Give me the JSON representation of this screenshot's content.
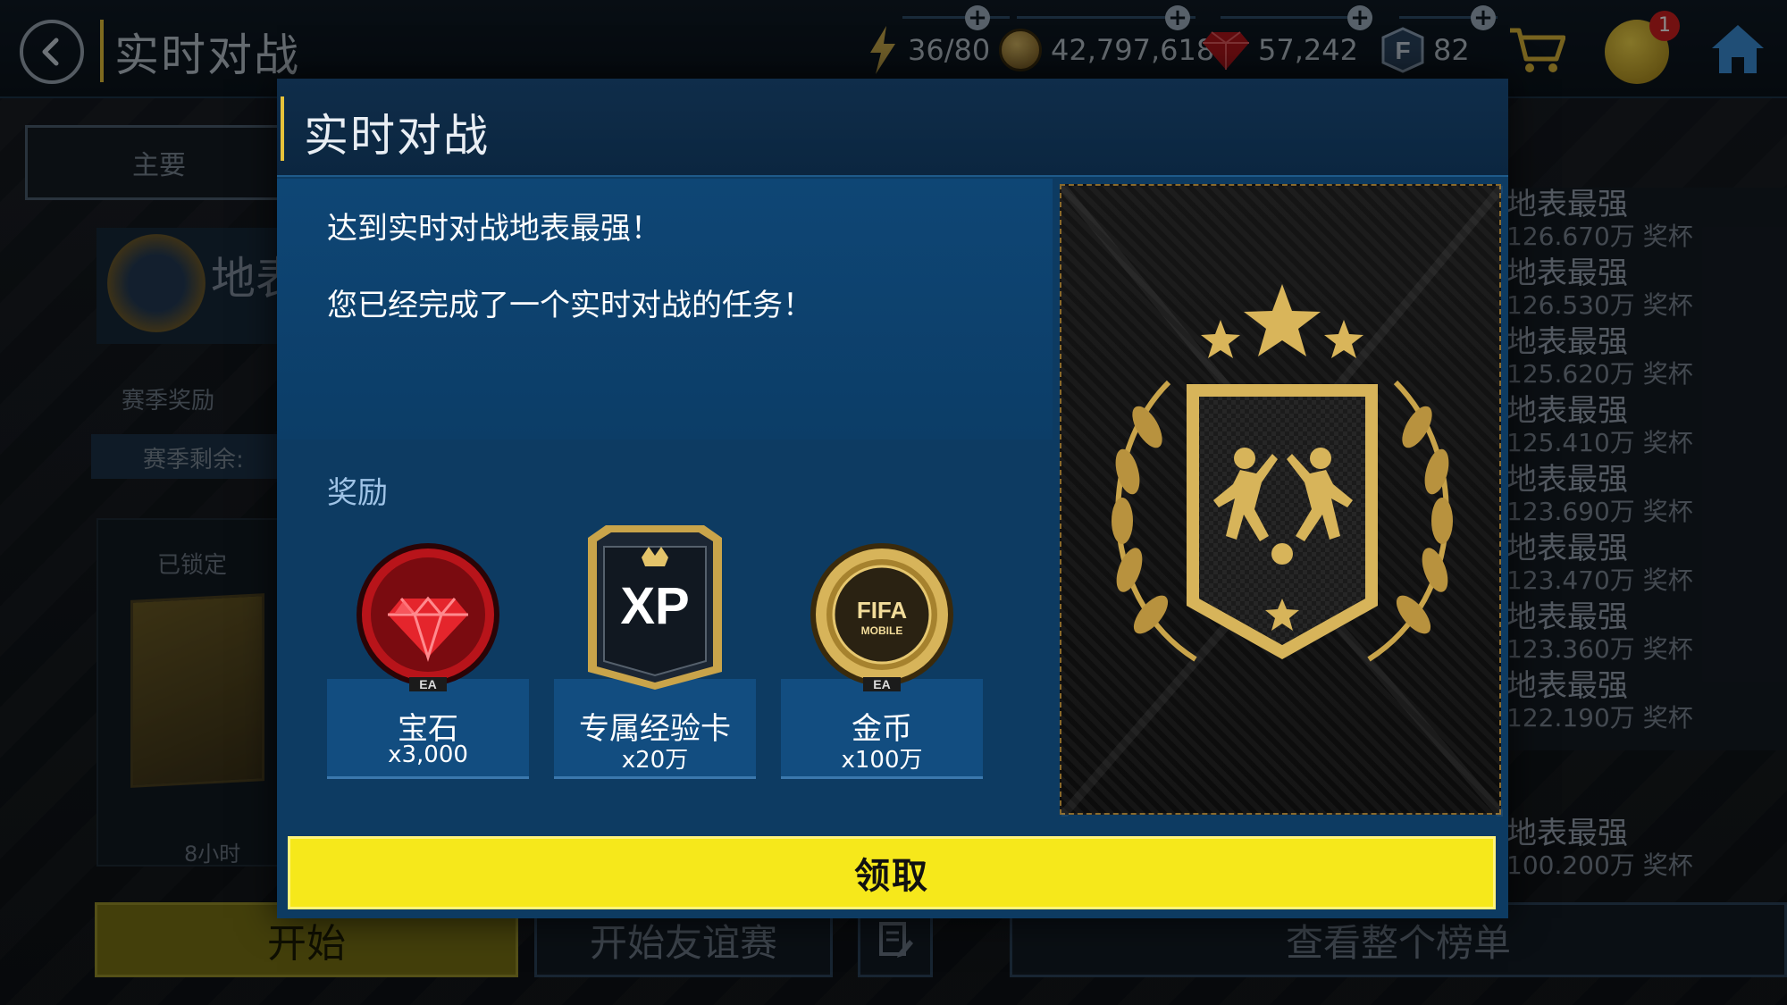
{
  "topbar": {
    "title": "实时对战",
    "energy": "36/80",
    "coins": "42,797,618",
    "gems": "57,242",
    "fifa_points": "82",
    "quest_badge": "1"
  },
  "background": {
    "tab_main": "主要",
    "card_title": "地表",
    "season_reward_label": "赛季奖励",
    "season_remaining_label": "赛季剩余:",
    "locked_label": "已锁定",
    "timer_label": "8小时",
    "leaderboard": [
      {
        "title": "地表最强",
        "sub": "126.670万 奖杯"
      },
      {
        "title": "地表最强",
        "sub": "126.530万 奖杯"
      },
      {
        "title": "地表最强",
        "sub": "125.620万 奖杯"
      },
      {
        "title": "地表最强",
        "sub": "125.410万 奖杯"
      },
      {
        "title": "地表最强",
        "sub": "123.690万 奖杯"
      },
      {
        "title": "地表最强",
        "sub": "123.470万 奖杯"
      },
      {
        "title": "地表最强",
        "sub": "123.360万 奖杯"
      },
      {
        "title": "地表最强",
        "sub": "122.190万 奖杯"
      },
      {
        "title": "地表最强",
        "sub": "100.200万 奖杯"
      }
    ],
    "start_button": "开始",
    "friendly_button": "开始友谊赛",
    "board_button": "查看整个榜单"
  },
  "modal": {
    "title": "实时对战",
    "message1": "达到实时对战地表最强！",
    "message2": "您已经完成了一个实时对战的任务！",
    "rewards_label": "奖励",
    "rewards": [
      {
        "name": "宝石",
        "qty": "x3,000",
        "icon": "gem-icon"
      },
      {
        "name": "专属经验卡",
        "qty": "x20万",
        "icon": "xp-card-icon"
      },
      {
        "name": "金币",
        "qty": "x100万",
        "icon": "coin-icon"
      }
    ],
    "claim_button": "领取"
  },
  "icon_text": {
    "xp": "XP",
    "fifa": "FIFA",
    "mobile": "MOBILE",
    "ea": "EA",
    "f": "F"
  },
  "colors": {
    "accent_yellow": "#f6e81b",
    "modal_blue": "#0d3b62",
    "gold": "#c9a44a"
  }
}
